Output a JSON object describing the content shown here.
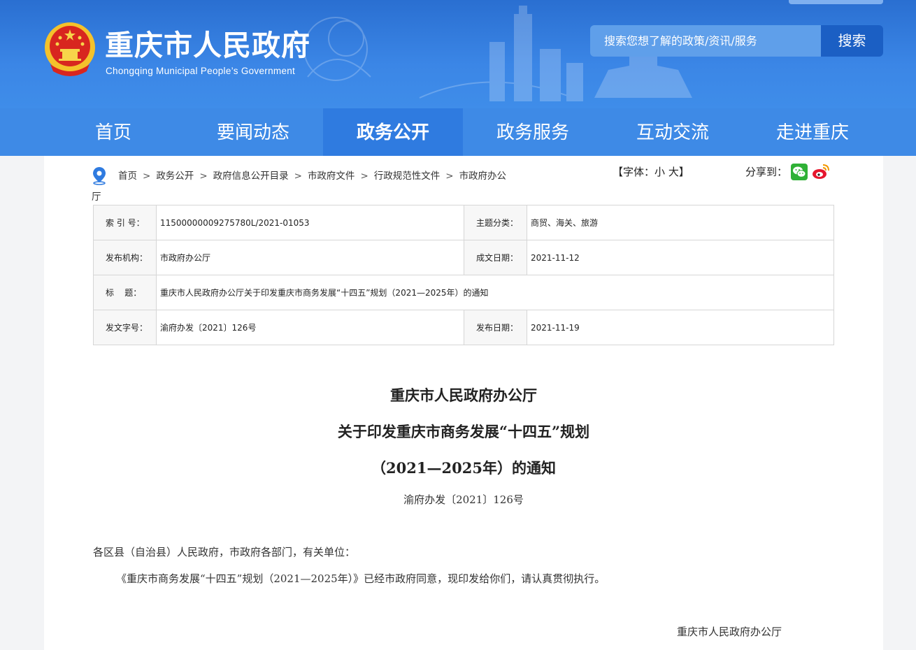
{
  "header": {
    "site_title": "重庆市人民政府",
    "site_subtitle": "Chongqing Municipal People’s Government",
    "search_placeholder": "搜索您想了解的政策/资讯/服务",
    "search_button": "搜索"
  },
  "nav": {
    "items": [
      {
        "label": "首页"
      },
      {
        "label": "要闻动态"
      },
      {
        "label": "政务公开"
      },
      {
        "label": "政务服务"
      },
      {
        "label": "互动交流"
      },
      {
        "label": "走进重庆"
      }
    ],
    "active": "政务公开"
  },
  "breadcrumb": {
    "items": [
      "首页",
      "政务公开",
      "政府信息公开目录",
      "市政府文件",
      "行政规范性文件",
      "市政府办公"
    ],
    "overflow": "厅",
    "separator": ">"
  },
  "tools": {
    "font_label": "【字体：",
    "font_small": "小",
    "font_large": "大",
    "font_close": "】",
    "share_label": "分享到："
  },
  "meta": {
    "index_label": "索 引 号：",
    "index_value": "11500000009275780L/2021-01053",
    "topic_label": "主题分类：",
    "topic_value": "商贸、海关、旅游",
    "issuer_label": "发布机构：",
    "issuer_value": "市政府办公厅",
    "written_label": "成文日期：",
    "written_value": "2021-11-12",
    "title_label": "标    题：",
    "title_value": "重庆市人民政府办公厅关于印发重庆市商务发展“十四五”规划（2021—2025年）的通知",
    "docno_label": "发文字号：",
    "docno_value": "渝府办发〔2021〕126号",
    "pubdate_label": "发布日期：",
    "pubdate_value": "2021-11-19"
  },
  "document": {
    "title_line1": "重庆市人民政府办公厅",
    "title_line2": "关于印发重庆市商务发展“十四五”规划",
    "title_line3": "（2021—2025年）的通知",
    "doc_no": "渝府办发〔2021〕126号",
    "salutation": "各区县（自治县）人民政府，市政府各部门，有关单位：",
    "paragraph": "《重庆市商务发展“十四五”规划（2021—2025年）》已经市政府同意，现印发给你们，请认真贯彻执行。",
    "signature": "重庆市人民政府办公厅"
  },
  "colors": {
    "header_blue": "#2a6fd1",
    "nav_blue": "#3e8ae6",
    "nav_active": "#2f7be0",
    "search_btn": "#1b5fc4"
  }
}
